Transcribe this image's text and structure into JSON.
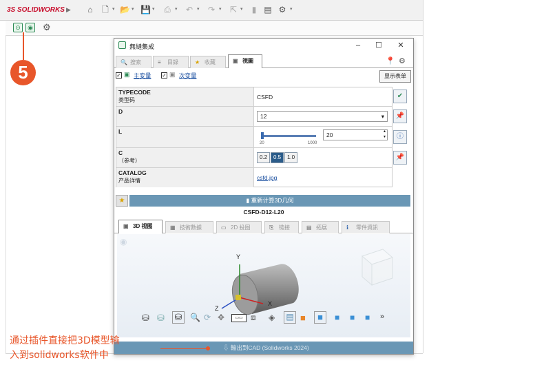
{
  "host": {
    "logo_prefix": "3S",
    "logo": "SOLIDWORKS",
    "toolbar_icons": [
      "home-icon",
      "new-doc-icon",
      "open-icon",
      "save-icon",
      "print-icon",
      "undo-icon",
      "redo-icon",
      "select-icon",
      "rebuild-icon",
      "file-props-icon",
      "options-icon"
    ],
    "callout_number": "5"
  },
  "window": {
    "title": "無縫集成",
    "min": "–",
    "max": "☐",
    "close": "✕"
  },
  "tabs": [
    {
      "label": "搜索",
      "icon": "🔍"
    },
    {
      "label": "目錄",
      "icon": "≡"
    },
    {
      "label": "收藏",
      "icon": "★"
    },
    {
      "label": "視圖",
      "icon": "▣"
    }
  ],
  "checks": {
    "main_var": "主变量",
    "sub_var": "次变量",
    "show_table": "显示表单"
  },
  "params": {
    "typecode_label": "TYPECODE",
    "typecode_sub": "类型码",
    "typecode_value": "CSFD",
    "d_label": "D",
    "d_value": "12",
    "l_label": "L",
    "l_value": "20",
    "l_min": "20",
    "l_max": "1000",
    "l_fraction": 0.0,
    "c_label": "C",
    "c_sub": "（参考）",
    "c_options": [
      "0.2",
      "0.5",
      "1.0"
    ],
    "c_selected": "0.5",
    "catalog_label": "CATALOG",
    "catalog_sub": "产品详情",
    "catalog_link": "csfd.jpg"
  },
  "recalc_label": "重新计算3D几何",
  "model_name": "CSFD-D12-L20",
  "lower_tabs": [
    {
      "label": "3D 视图",
      "icon": "▣"
    },
    {
      "label": "技術數據",
      "icon": "▦"
    },
    {
      "label": "2D 投图",
      "icon": "▭"
    },
    {
      "label": "链接",
      "icon": "⎘"
    },
    {
      "label": "拓展",
      "icon": "▤"
    },
    {
      "label": "零件資訊",
      "icon": "ℹ"
    }
  ],
  "viewport": {
    "axis_x": "X",
    "axis_y": "Y",
    "axis_z": "Z",
    "more": "»"
  },
  "export_label": "輸出到CAD (Solidworks 2024)",
  "annotation": {
    "line1": "通过插件直接把3D模型输",
    "line2": "入到solidworks软件中"
  }
}
